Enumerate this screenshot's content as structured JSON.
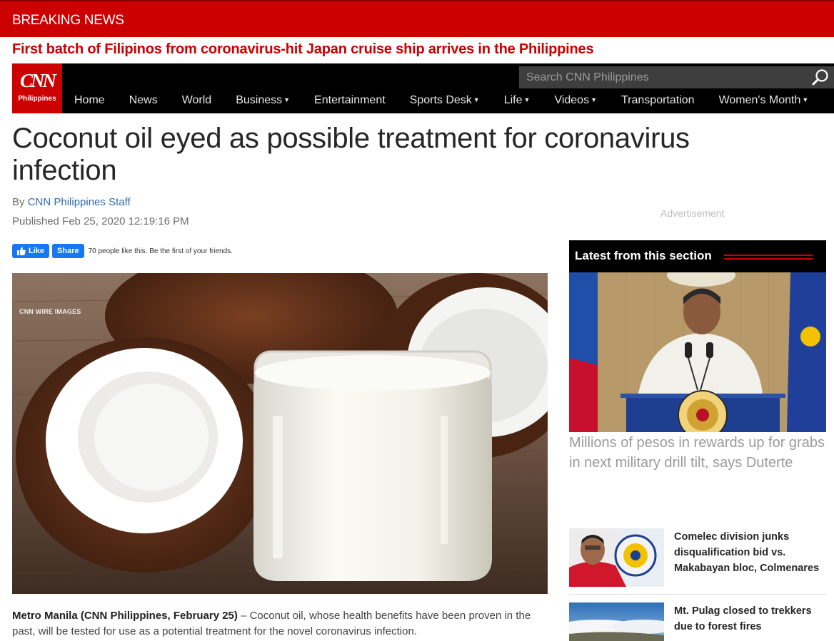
{
  "breaking": {
    "label": "BREAKING NEWS",
    "headline": "First batch of Filipinos from coronavirus-hit Japan cruise ship arrives in the Philippines"
  },
  "nav": {
    "logo_text": "CNN",
    "logo_sub": "Philippines",
    "search_placeholder": "Search CNN Philippines",
    "items": [
      {
        "label": "Home",
        "dropdown": false
      },
      {
        "label": "News",
        "dropdown": false
      },
      {
        "label": "World",
        "dropdown": false
      },
      {
        "label": "Business",
        "dropdown": true
      },
      {
        "label": "Entertainment",
        "dropdown": false
      },
      {
        "label": "Sports Desk",
        "dropdown": true
      },
      {
        "label": "Life",
        "dropdown": true
      },
      {
        "label": "Videos",
        "dropdown": true
      },
      {
        "label": "Transportation",
        "dropdown": false
      },
      {
        "label": "Women's Month",
        "dropdown": true
      }
    ]
  },
  "article": {
    "title": "Coconut oil eyed as possible treatment for coronavirus infection",
    "by_prefix": "By",
    "author": "CNN Philippines Staff",
    "published": "Published Feb 25, 2020 12:19:16 PM",
    "like_label": "Like",
    "share_label": "Share",
    "like_text": "70 people like this. Be the first of your friends.",
    "image_credit": "CNN WIRE IMAGES",
    "dateline": "Metro Manila (CNN Philippines, February 25)",
    "lede": " – Coconut oil, whose health benefits have been proven in the past, will be tested for use as a potential treatment for the novel coronavirus infection."
  },
  "sidebar": {
    "advertisement": "Advertisement",
    "latest_title": "Latest from this section",
    "main_story": "Millions of pesos in rewards up for grabs in next military drill tilt, says Duterte",
    "stories": [
      {
        "title": "Comelec division junks disqualification bid vs. Makabayan bloc, Colmenares"
      },
      {
        "title": "Mt. Pulag closed to trekkers due to forest fires"
      }
    ]
  },
  "colors": {
    "brand_red": "#cc0000",
    "nav_bg": "#000000",
    "link_blue": "#2f6cb3",
    "facebook_blue": "#1877f2"
  },
  "icons": [
    "search-icon",
    "thumbs-up-icon"
  ]
}
